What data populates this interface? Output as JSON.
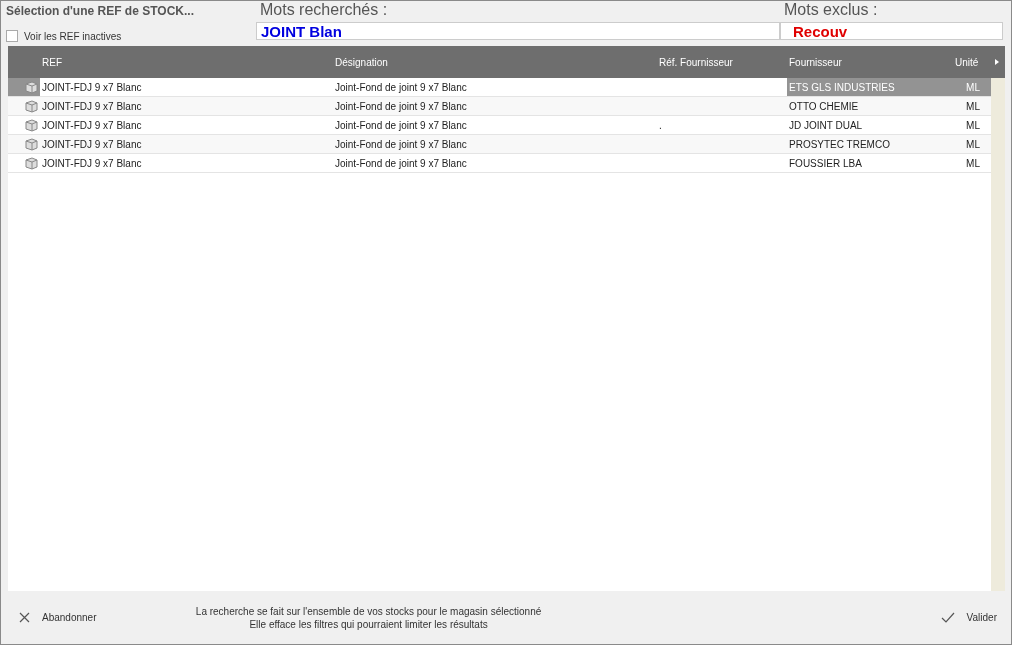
{
  "window": {
    "title": "Sélection d'une REF de STOCK..."
  },
  "inactive_toggle": {
    "label": "Voir les REF inactives",
    "checked": false
  },
  "search": {
    "label": "Mots recherchés :",
    "value": "JOINT Blan"
  },
  "exclude": {
    "label": "Mots exclus :",
    "value": "Recouv"
  },
  "table": {
    "columns": [
      "REF",
      "Désignation",
      "Réf. Fournisseur",
      "Fournisseur",
      "Unité"
    ],
    "rows": [
      {
        "ref": "JOINT-FDJ 9 x7 Blanc",
        "designation": "Joint-Fond de joint 9 x7 Blanc",
        "supplier_ref": "",
        "supplier": "ETS GLS INDUSTRIES",
        "unit": "ML",
        "selected": true
      },
      {
        "ref": "JOINT-FDJ 9 x7 Blanc",
        "designation": "Joint-Fond de joint 9 x7 Blanc",
        "supplier_ref": "",
        "supplier": "OTTO CHEMIE",
        "unit": "ML",
        "selected": false
      },
      {
        "ref": "JOINT-FDJ 9 x7 Blanc",
        "designation": "Joint-Fond de joint 9 x7 Blanc",
        "supplier_ref": ".",
        "supplier": "JD JOINT DUAL",
        "unit": "ML",
        "selected": false
      },
      {
        "ref": "JOINT-FDJ 9 x7 Blanc",
        "designation": "Joint-Fond de joint 9 x7 Blanc",
        "supplier_ref": "",
        "supplier": "PROSYTEC TREMCO",
        "unit": "ML",
        "selected": false
      },
      {
        "ref": "JOINT-FDJ 9 x7 Blanc",
        "designation": "Joint-Fond de joint 9 x7 Blanc",
        "supplier_ref": "",
        "supplier": "FOUSSIER LBA",
        "unit": "ML",
        "selected": false
      }
    ]
  },
  "footer": {
    "cancel": "Abandonner",
    "notes": [
      "La recherche se fait sur l'ensemble de vos stocks pour le magasin sélectionné",
      "Elle efface les filtres qui pourraient limiter les résultats"
    ],
    "confirm": "Valider"
  }
}
